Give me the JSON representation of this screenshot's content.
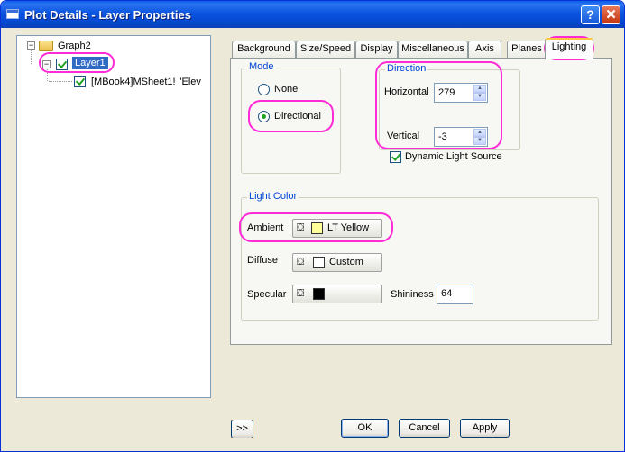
{
  "window": {
    "title": "Plot Details - Layer Properties",
    "help_glyph": "?",
    "close_glyph": "✕"
  },
  "tree": {
    "root": "Graph2",
    "layer": "Layer1",
    "dataset": "[MBook4]MSheet1! \"Elev",
    "collapse_glyph": "−"
  },
  "tabs": [
    {
      "label": "Background"
    },
    {
      "label": "Size/Speed"
    },
    {
      "label": "Display"
    },
    {
      "label": "Miscellaneous"
    },
    {
      "label": "Axis"
    },
    {
      "label": "Planes"
    },
    {
      "label": "Lighting"
    }
  ],
  "active_tab": "Lighting",
  "mode": {
    "title": "Mode",
    "none_label": "None",
    "directional_label": "Directional",
    "selected": "Directional"
  },
  "direction": {
    "title": "Direction",
    "horizontal_label": "Horizontal",
    "horizontal_value": "279",
    "vertical_label": "Vertical",
    "vertical_value": "-3",
    "dynamic_label": "Dynamic Light Source",
    "dynamic_checked": true
  },
  "light_color": {
    "title": "Light Color",
    "ambient_label": "Ambient",
    "ambient_color_name": "LT Yellow",
    "ambient_color": "#ffff99",
    "diffuse_label": "Diffuse",
    "diffuse_color_name": "Custom",
    "diffuse_color": "#ffffff",
    "specular_label": "Specular",
    "specular_color": "#000000",
    "shininess_label": "Shininess",
    "shininess_value": "64"
  },
  "buttons": {
    "expand": ">>",
    "ok": "OK",
    "cancel": "Cancel",
    "apply": "Apply"
  },
  "colors": {
    "highlight": "#ff2bd6",
    "titlebar": "#0a54e0",
    "group_title": "#0046d5"
  }
}
